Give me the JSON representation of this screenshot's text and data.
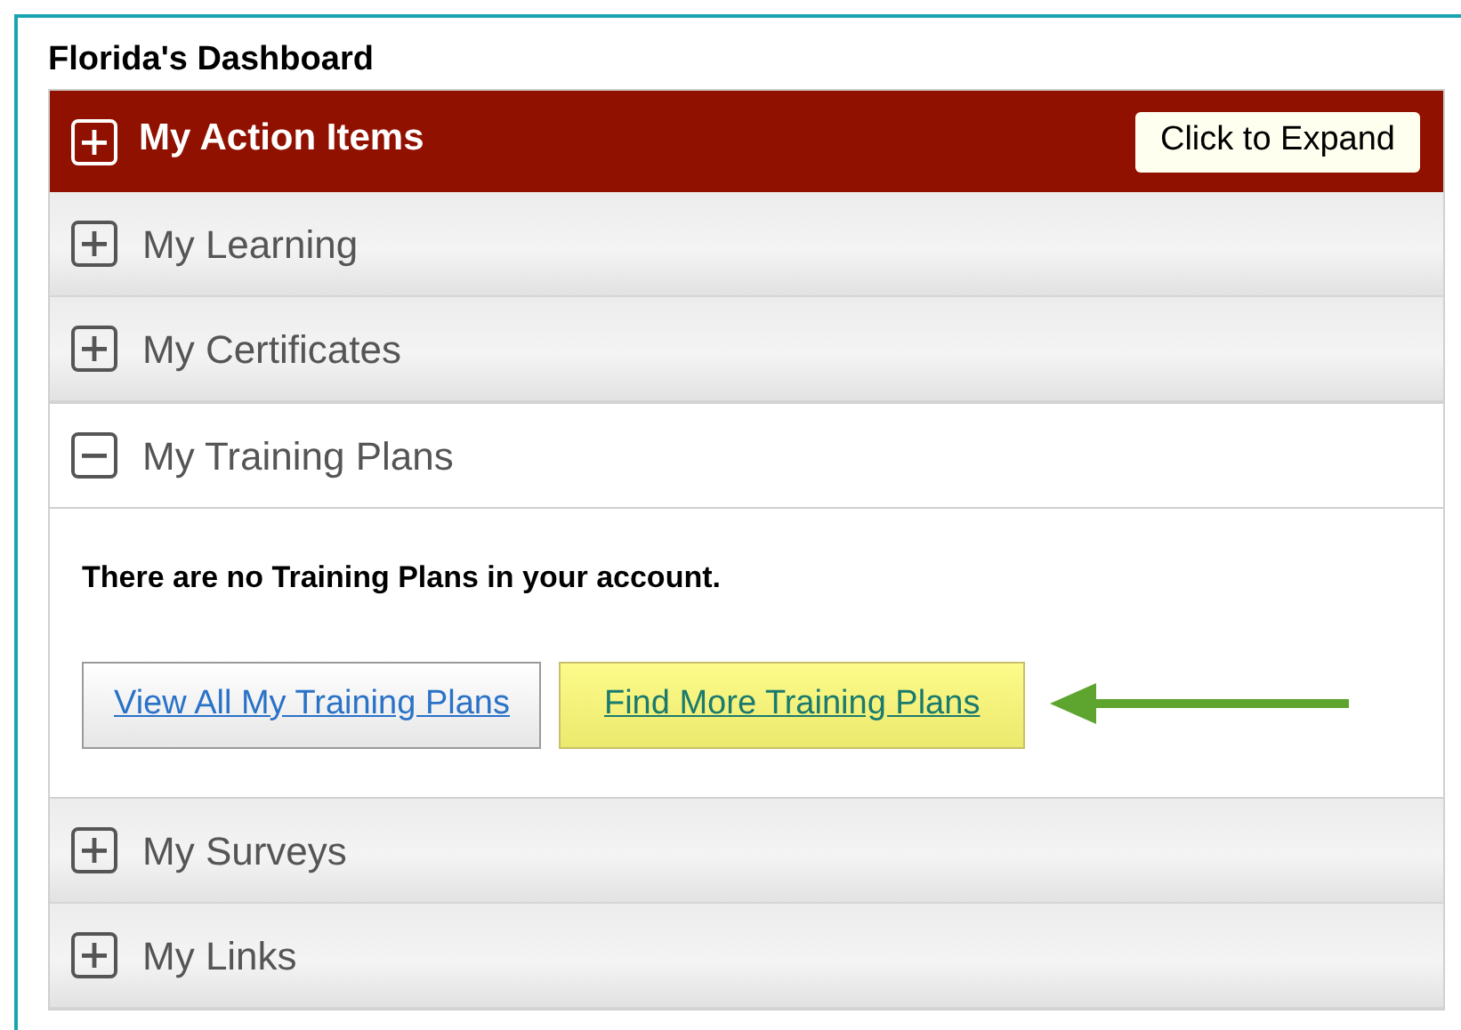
{
  "dashboard": {
    "title": "Florida's Dashboard",
    "sections": [
      {
        "kind": "featured",
        "label": "My Action Items",
        "expanded": false,
        "action": "Click to Expand"
      },
      {
        "kind": "plain",
        "label": "My Learning",
        "expanded": false
      },
      {
        "kind": "plain",
        "label": "My Certificates",
        "expanded": false
      },
      {
        "kind": "plain",
        "label": "My Training Plans",
        "expanded": true,
        "message": "There are no Training Plans in your account.",
        "links": [
          {
            "label": "View All My Training Plans",
            "highlighted": false
          },
          {
            "label": "Find More Training Plans",
            "highlighted": true
          }
        ]
      },
      {
        "kind": "plain",
        "label": "My Surveys",
        "expanded": false
      },
      {
        "kind": "plain",
        "label": "My Links",
        "expanded": false
      }
    ]
  }
}
